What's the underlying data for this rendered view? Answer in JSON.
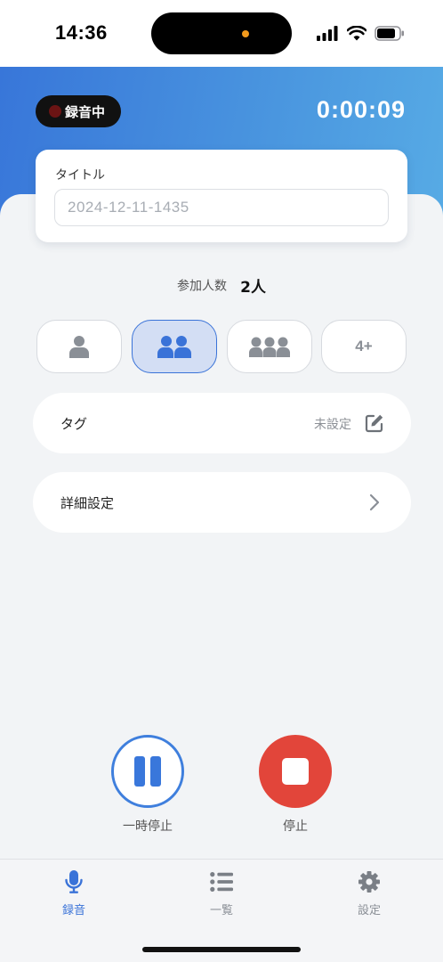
{
  "status_bar": {
    "time": "14:36"
  },
  "header": {
    "recording_badge": "録音中",
    "timer": "0:00:09"
  },
  "title_card": {
    "label": "タイトル",
    "placeholder": "2024-12-11-1435"
  },
  "participants": {
    "label": "参加人数",
    "value": "2人",
    "options": [
      "1",
      "2",
      "3",
      "4+"
    ],
    "selected_index": 1
  },
  "tag_row": {
    "label": "タグ",
    "value": "未設定"
  },
  "details_row": {
    "label": "詳細設定"
  },
  "controls": {
    "pause_label": "一時停止",
    "stop_label": "停止"
  },
  "tabbar": {
    "items": [
      {
        "label": "録音",
        "icon": "mic-icon",
        "active": true
      },
      {
        "label": "一覧",
        "icon": "list-icon",
        "active": false
      },
      {
        "label": "設定",
        "icon": "gear-icon",
        "active": false
      }
    ]
  },
  "colors": {
    "accent": "#3a73d8",
    "stop": "#e2453a",
    "header_start": "#3876d9",
    "header_end": "#57abe5"
  }
}
